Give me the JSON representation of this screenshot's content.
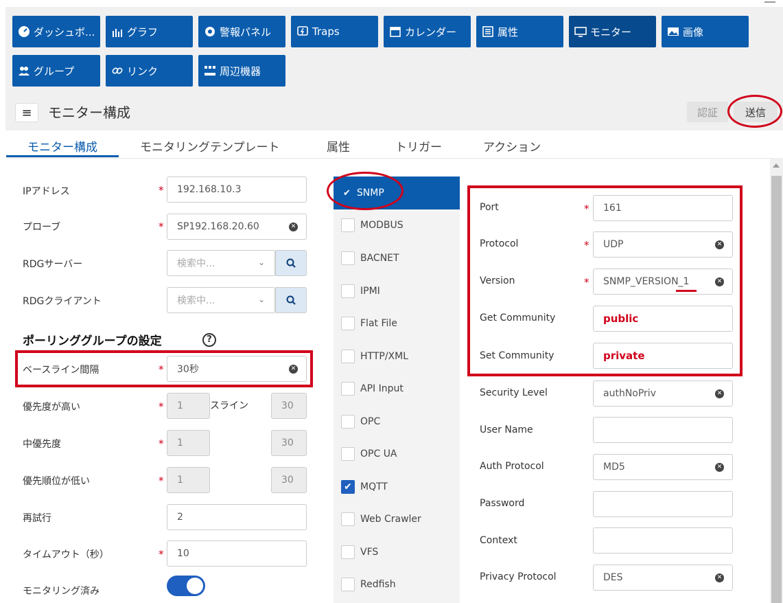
{
  "nav": {
    "row1": [
      {
        "label": "ダッシュボ...",
        "icon": "dashboard-icon"
      },
      {
        "label": "グラフ",
        "icon": "graph-icon"
      },
      {
        "label": "警報パネル",
        "icon": "alarm-panel-icon"
      },
      {
        "label": "Traps",
        "icon": "traps-icon"
      },
      {
        "label": "カレンダー",
        "icon": "calendar-icon"
      },
      {
        "label": "属性",
        "icon": "attribute-icon"
      },
      {
        "label": "モニター",
        "icon": "monitor-icon"
      },
      {
        "label": "画像",
        "icon": "image-icon"
      }
    ],
    "row2": [
      {
        "label": "グループ",
        "icon": "group-icon"
      },
      {
        "label": "リンク",
        "icon": "link-icon"
      },
      {
        "label": "周辺機器",
        "icon": "peripheral-icon"
      }
    ]
  },
  "header": {
    "title": "モニター構成",
    "auth_label": "認証",
    "send_label": "送信"
  },
  "tabs": [
    "モニター構成",
    "モニタリングテンプレート",
    "属性",
    "トリガー",
    "アクション"
  ],
  "form": {
    "ip_label": "IPアドレス",
    "ip_value": "192.168.10.3",
    "probe_label": "プローブ",
    "probe_value": "SP192.168.20.60",
    "rdg_server_label": "RDGサーバー",
    "rdg_server_placeholder": "検索中...",
    "rdg_client_label": "RDGクライアント",
    "rdg_client_placeholder": "検索中...",
    "polling_title": "ポーリンググループの設定",
    "baseline_label": "ベースライン間隔",
    "baseline_value": "30秒",
    "high_label": "優先度が高い",
    "high_value": "1",
    "high_suffix": "スライン",
    "high_interval": "30",
    "mid_label": "中優先度",
    "mid_value": "1",
    "mid_interval": "30",
    "low_label": "優先順位が低い",
    "low_value": "1",
    "low_interval": "30",
    "retry_label": "再試行",
    "retry_value": "2",
    "timeout_label": "タイムアウト（秒）",
    "timeout_value": "10",
    "monitored_label": "モニタリング済み"
  },
  "protocols": [
    "SNMP",
    "MODBUS",
    "BACNET",
    "IPMI",
    "Flat File",
    "HTTP/XML",
    "API Input",
    "OPC",
    "OPC UA",
    "MQTT",
    "Web Crawler",
    "VFS",
    "Redfish"
  ],
  "snmp": {
    "port_label": "Port",
    "port_value": "161",
    "protocol_label": "Protocol",
    "protocol_value": "UDP",
    "version_label": "Version",
    "version_value": "SNMP_VERSION_1",
    "get_label": "Get Community",
    "get_value": "public",
    "set_label": "Set Community",
    "set_value": "private",
    "security_label": "Security Level",
    "security_value": "authNoPriv",
    "user_label": "User Name",
    "user_value": "",
    "auth_label": "Auth Protocol",
    "auth_value": "MD5",
    "password_label": "Password",
    "password_value": "",
    "context_label": "Context",
    "context_value": "",
    "privacy_label": "Privacy Protocol",
    "privacy_value": "DES"
  },
  "colors": {
    "primary": "#0b5cad",
    "annotation": "#d0021b",
    "toggle_on": "#1f5fbf"
  }
}
